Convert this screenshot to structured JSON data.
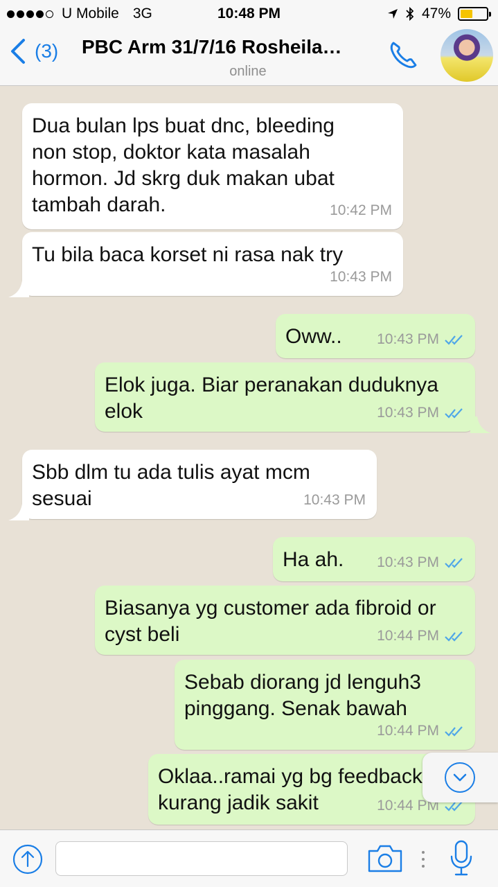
{
  "status_bar": {
    "carrier": "U Mobile",
    "network": "3G",
    "time": "10:48 PM",
    "battery": "47%",
    "battery_level": 0.47
  },
  "header": {
    "back_count": "(3)",
    "title": "PBC Arm 31/7/16 Rosheila…",
    "subtitle": "online"
  },
  "messages": [
    {
      "dir": "in",
      "text": "Dua bulan lps buat dnc, bleeding\nnon stop, doktor kata masalah\nhormon. Jd skrg duk makan ubat\ntambah darah.",
      "time": "10:42 PM"
    },
    {
      "dir": "in",
      "text": "Tu bila baca korset ni rasa nak try",
      "time": "10:43 PM"
    },
    {
      "dir": "out",
      "text": "Oww..",
      "time": "10:43 PM"
    },
    {
      "dir": "out",
      "text": "Elok juga. Biar peranakan duduknya\nelok",
      "time": "10:43 PM"
    },
    {
      "dir": "in",
      "text": "Sbb dlm tu ada tulis ayat mcm\nsesuai",
      "time": "10:43 PM"
    },
    {
      "dir": "out",
      "text": "Ha ah.",
      "time": "10:43 PM"
    },
    {
      "dir": "out",
      "text": "Biasanya yg customer ada fibroid or\ncyst beli",
      "time": "10:44 PM"
    },
    {
      "dir": "out",
      "text": "Sebab diorang jd lenguh3\npinggang. Senak bawah",
      "time": "10:44 PM"
    },
    {
      "dir": "out",
      "text": "Oklaa..ramai yg bg feedback\nkurang jadik sakit",
      "time": "10:44 PM"
    }
  ],
  "input": {
    "placeholder": ""
  },
  "colors": {
    "accent": "#1a7ee6",
    "incoming_bubble": "#ffffff",
    "outgoing_bubble": "#dcf8c6",
    "read_ticks": "#4fa6e8",
    "battery": "#f5c400"
  },
  "icons": {
    "back": "chevron-left-icon",
    "call": "phone-icon",
    "upload": "upload-arrow-icon",
    "camera": "camera-icon",
    "more": "more-vertical-icon",
    "mic": "microphone-icon",
    "scroll": "chevron-down-icon",
    "read": "double-check-icon"
  }
}
